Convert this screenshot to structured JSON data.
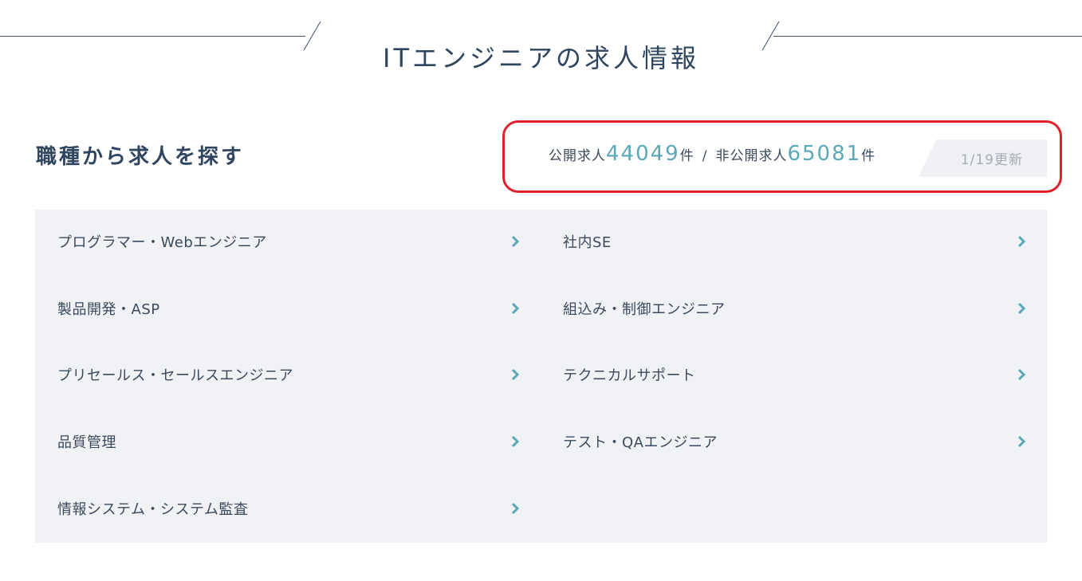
{
  "header": {
    "title": "ITエンジニアの求人情報"
  },
  "section": {
    "heading": "職種から求人を探す"
  },
  "stats": {
    "public_label": "公開求人",
    "public_count": "44049",
    "unit": "件",
    "separator": "/",
    "private_label": "非公開求人",
    "private_count": "65081",
    "updated": "1/19更新"
  },
  "categories": {
    "left": [
      {
        "label": "プログラマー・Webエンジニア"
      },
      {
        "label": "製品開発・ASP"
      },
      {
        "label": "プリセールス・セールスエンジニア"
      },
      {
        "label": "品質管理"
      },
      {
        "label": "情報システム・システム監査"
      }
    ],
    "right": [
      {
        "label": "社内SE"
      },
      {
        "label": "組込み・制御エンジニア"
      },
      {
        "label": "テクニカルサポート"
      },
      {
        "label": "テスト・QAエンジニア"
      }
    ]
  },
  "colors": {
    "accent": "#5aa8ba",
    "highlight_border": "#e0202a",
    "panel_bg": "#f1f2f6",
    "title_text": "#2f4560"
  },
  "icons": {
    "item_arrow": "chevron-right-icon"
  }
}
